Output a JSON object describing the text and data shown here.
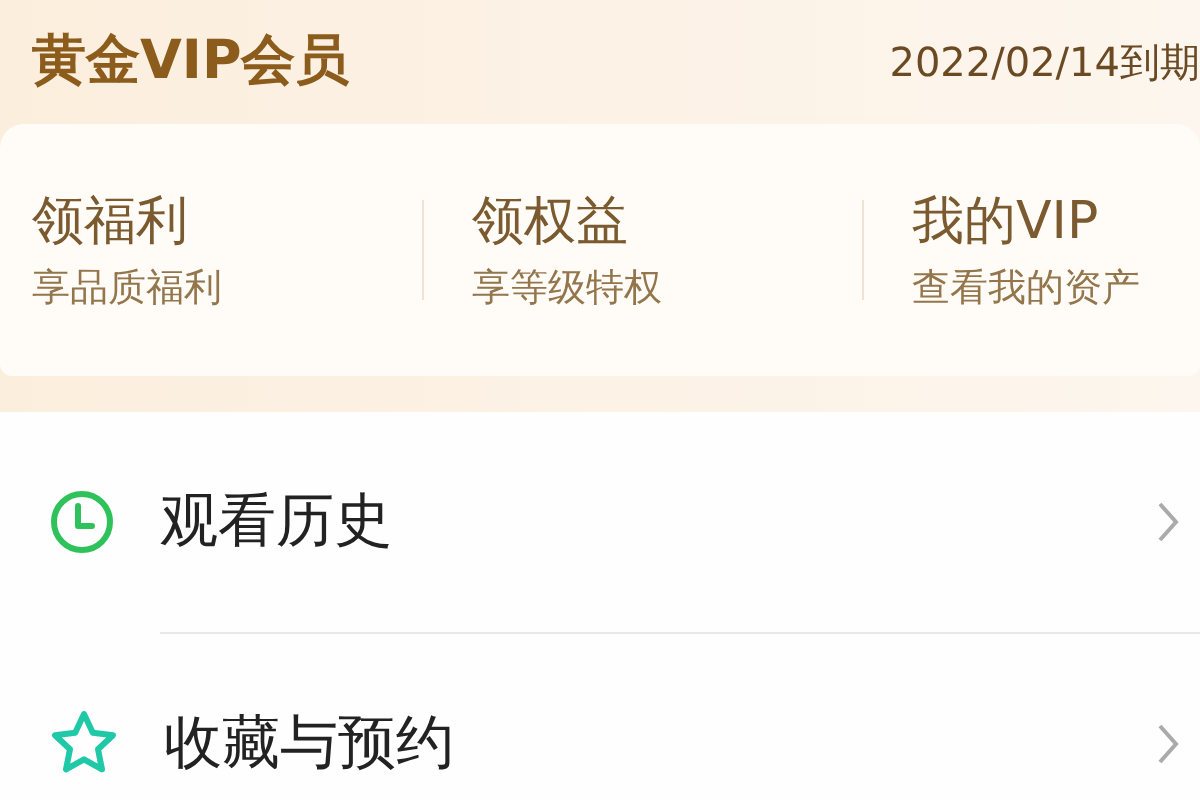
{
  "header": {
    "title": "黄金VIP会员",
    "expiry": "2022/02/14到期"
  },
  "benefits": [
    {
      "title": "领福利",
      "subtitle": "享品质福利"
    },
    {
      "title": "领权益",
      "subtitle": "享等级特权"
    },
    {
      "title": "我的VIP",
      "subtitle": "查看我的资产"
    }
  ],
  "menu": [
    {
      "kind": "clock",
      "label": "观看历史"
    },
    {
      "kind": "star",
      "label": "收藏与预约"
    }
  ]
}
